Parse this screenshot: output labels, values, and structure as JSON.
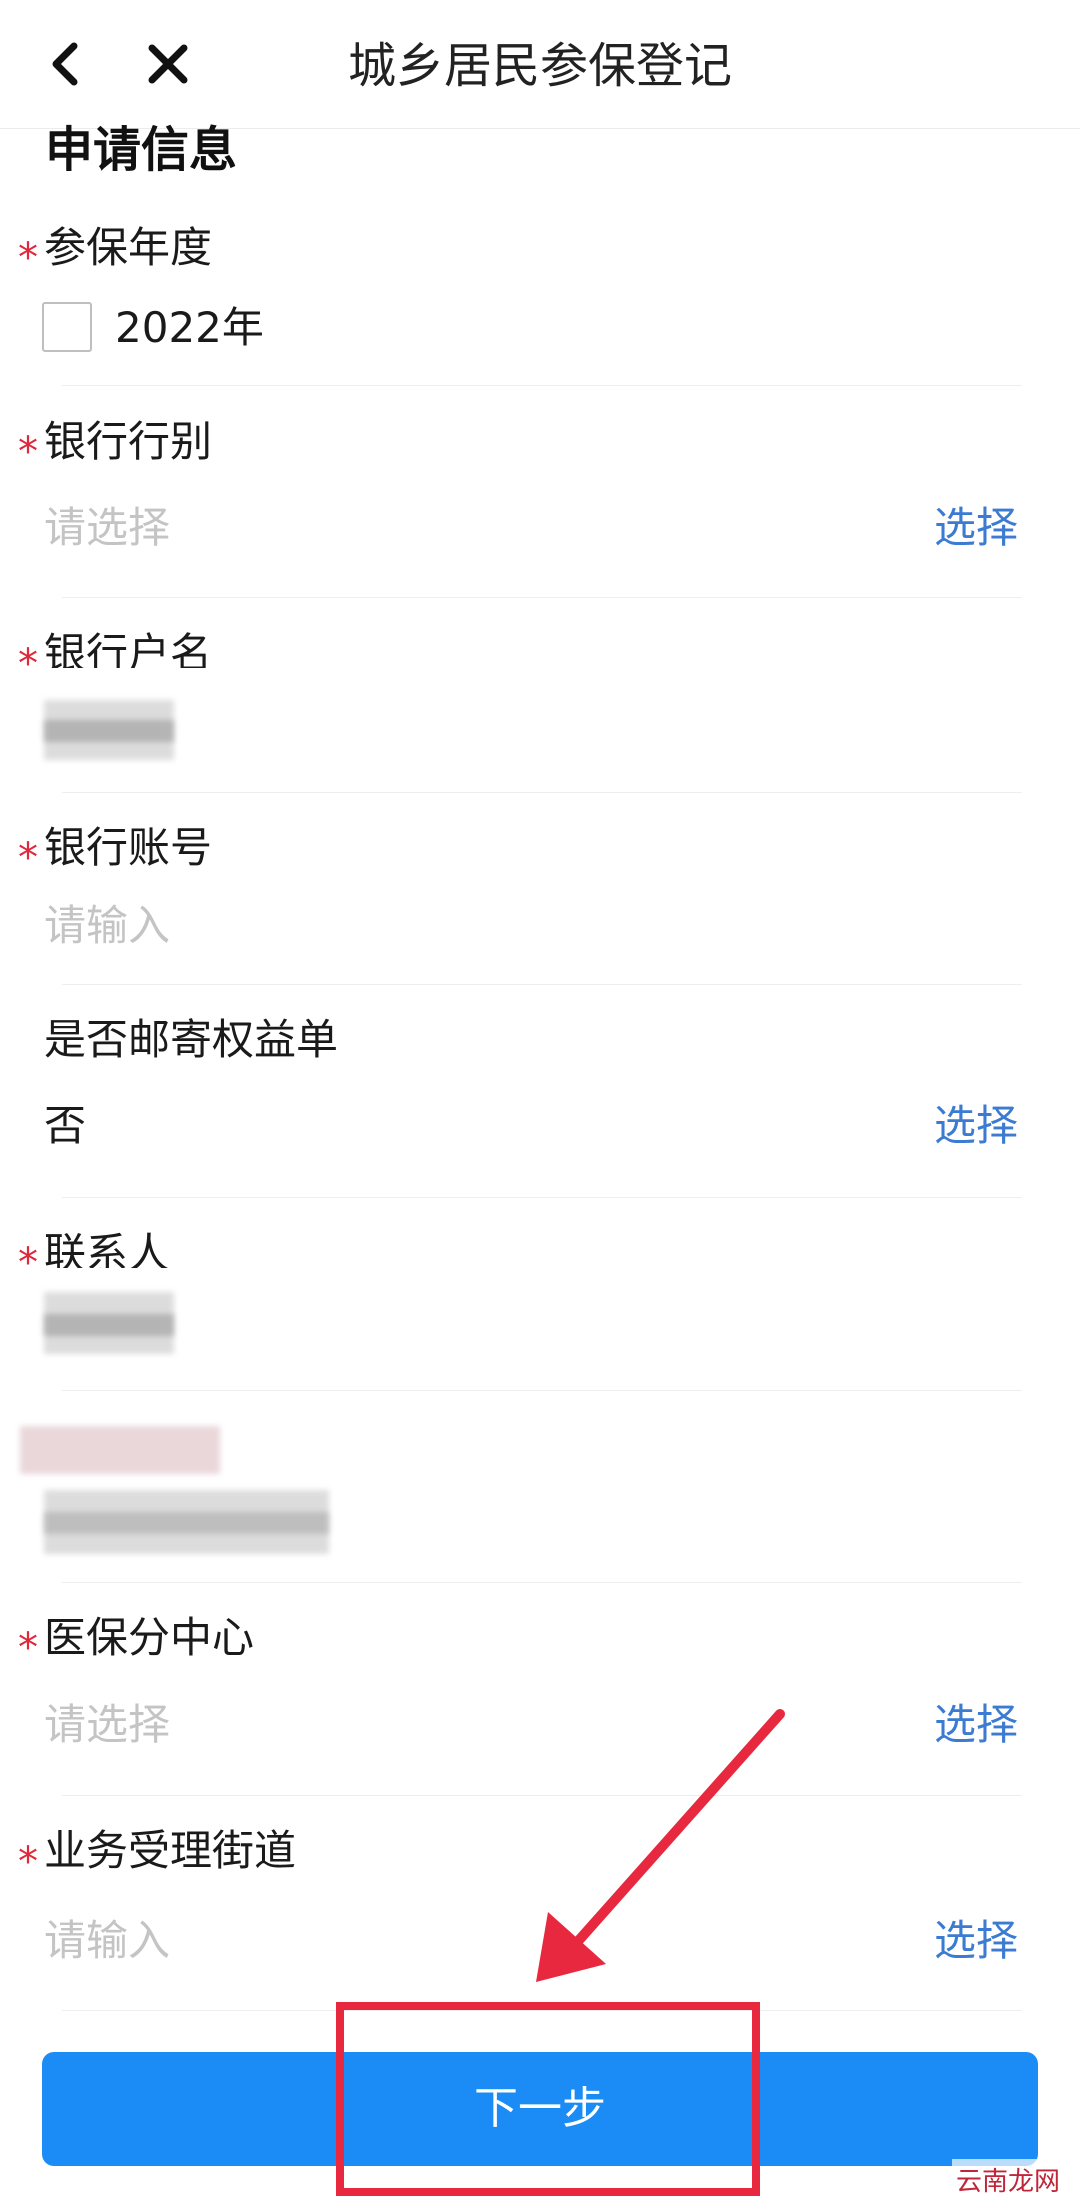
{
  "navbar": {
    "title": "城乡居民参保登记",
    "back_icon": "chevron-left-icon",
    "close_icon": "close-icon"
  },
  "section_title": "申请信息",
  "required_mark": "*",
  "fields": {
    "year": {
      "label": "参保年度",
      "option": "2022年",
      "checked": false
    },
    "bank_type": {
      "label": "银行行别",
      "placeholder": "请选择",
      "action": "选择"
    },
    "account_name": {
      "label": "银行户名"
    },
    "account_no": {
      "label": "银行账号",
      "placeholder": "请输入"
    },
    "mail": {
      "label": "是否邮寄权益单",
      "value": "否",
      "action": "选择"
    },
    "contact": {
      "label": "联系人"
    },
    "medical_center": {
      "label": "医保分中心",
      "placeholder": "请选择",
      "action": "选择"
    },
    "street": {
      "label": "业务受理街道",
      "placeholder": "请输入",
      "action": "选择"
    }
  },
  "next_button": "下一步",
  "watermark": "云南龙网",
  "colors": {
    "accent": "#1b8cf5",
    "link": "#3b7bd1",
    "required": "#e0283c",
    "annotation": "#e8283e"
  }
}
